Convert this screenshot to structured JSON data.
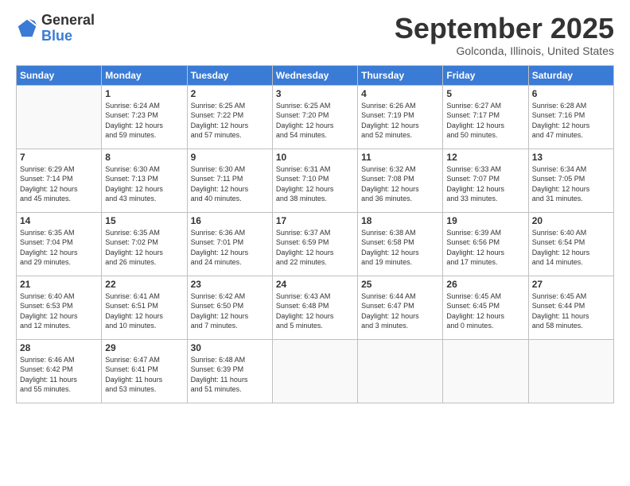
{
  "header": {
    "logo_general": "General",
    "logo_blue": "Blue",
    "month_title": "September 2025",
    "location": "Golconda, Illinois, United States"
  },
  "days_of_week": [
    "Sunday",
    "Monday",
    "Tuesday",
    "Wednesday",
    "Thursday",
    "Friday",
    "Saturday"
  ],
  "weeks": [
    [
      {
        "day": "",
        "info": ""
      },
      {
        "day": "1",
        "info": "Sunrise: 6:24 AM\nSunset: 7:23 PM\nDaylight: 12 hours\nand 59 minutes."
      },
      {
        "day": "2",
        "info": "Sunrise: 6:25 AM\nSunset: 7:22 PM\nDaylight: 12 hours\nand 57 minutes."
      },
      {
        "day": "3",
        "info": "Sunrise: 6:25 AM\nSunset: 7:20 PM\nDaylight: 12 hours\nand 54 minutes."
      },
      {
        "day": "4",
        "info": "Sunrise: 6:26 AM\nSunset: 7:19 PM\nDaylight: 12 hours\nand 52 minutes."
      },
      {
        "day": "5",
        "info": "Sunrise: 6:27 AM\nSunset: 7:17 PM\nDaylight: 12 hours\nand 50 minutes."
      },
      {
        "day": "6",
        "info": "Sunrise: 6:28 AM\nSunset: 7:16 PM\nDaylight: 12 hours\nand 47 minutes."
      }
    ],
    [
      {
        "day": "7",
        "info": "Sunrise: 6:29 AM\nSunset: 7:14 PM\nDaylight: 12 hours\nand 45 minutes."
      },
      {
        "day": "8",
        "info": "Sunrise: 6:30 AM\nSunset: 7:13 PM\nDaylight: 12 hours\nand 43 minutes."
      },
      {
        "day": "9",
        "info": "Sunrise: 6:30 AM\nSunset: 7:11 PM\nDaylight: 12 hours\nand 40 minutes."
      },
      {
        "day": "10",
        "info": "Sunrise: 6:31 AM\nSunset: 7:10 PM\nDaylight: 12 hours\nand 38 minutes."
      },
      {
        "day": "11",
        "info": "Sunrise: 6:32 AM\nSunset: 7:08 PM\nDaylight: 12 hours\nand 36 minutes."
      },
      {
        "day": "12",
        "info": "Sunrise: 6:33 AM\nSunset: 7:07 PM\nDaylight: 12 hours\nand 33 minutes."
      },
      {
        "day": "13",
        "info": "Sunrise: 6:34 AM\nSunset: 7:05 PM\nDaylight: 12 hours\nand 31 minutes."
      }
    ],
    [
      {
        "day": "14",
        "info": "Sunrise: 6:35 AM\nSunset: 7:04 PM\nDaylight: 12 hours\nand 29 minutes."
      },
      {
        "day": "15",
        "info": "Sunrise: 6:35 AM\nSunset: 7:02 PM\nDaylight: 12 hours\nand 26 minutes."
      },
      {
        "day": "16",
        "info": "Sunrise: 6:36 AM\nSunset: 7:01 PM\nDaylight: 12 hours\nand 24 minutes."
      },
      {
        "day": "17",
        "info": "Sunrise: 6:37 AM\nSunset: 6:59 PM\nDaylight: 12 hours\nand 22 minutes."
      },
      {
        "day": "18",
        "info": "Sunrise: 6:38 AM\nSunset: 6:58 PM\nDaylight: 12 hours\nand 19 minutes."
      },
      {
        "day": "19",
        "info": "Sunrise: 6:39 AM\nSunset: 6:56 PM\nDaylight: 12 hours\nand 17 minutes."
      },
      {
        "day": "20",
        "info": "Sunrise: 6:40 AM\nSunset: 6:54 PM\nDaylight: 12 hours\nand 14 minutes."
      }
    ],
    [
      {
        "day": "21",
        "info": "Sunrise: 6:40 AM\nSunset: 6:53 PM\nDaylight: 12 hours\nand 12 minutes."
      },
      {
        "day": "22",
        "info": "Sunrise: 6:41 AM\nSunset: 6:51 PM\nDaylight: 12 hours\nand 10 minutes."
      },
      {
        "day": "23",
        "info": "Sunrise: 6:42 AM\nSunset: 6:50 PM\nDaylight: 12 hours\nand 7 minutes."
      },
      {
        "day": "24",
        "info": "Sunrise: 6:43 AM\nSunset: 6:48 PM\nDaylight: 12 hours\nand 5 minutes."
      },
      {
        "day": "25",
        "info": "Sunrise: 6:44 AM\nSunset: 6:47 PM\nDaylight: 12 hours\nand 3 minutes."
      },
      {
        "day": "26",
        "info": "Sunrise: 6:45 AM\nSunset: 6:45 PM\nDaylight: 12 hours\nand 0 minutes."
      },
      {
        "day": "27",
        "info": "Sunrise: 6:45 AM\nSunset: 6:44 PM\nDaylight: 11 hours\nand 58 minutes."
      }
    ],
    [
      {
        "day": "28",
        "info": "Sunrise: 6:46 AM\nSunset: 6:42 PM\nDaylight: 11 hours\nand 55 minutes."
      },
      {
        "day": "29",
        "info": "Sunrise: 6:47 AM\nSunset: 6:41 PM\nDaylight: 11 hours\nand 53 minutes."
      },
      {
        "day": "30",
        "info": "Sunrise: 6:48 AM\nSunset: 6:39 PM\nDaylight: 11 hours\nand 51 minutes."
      },
      {
        "day": "",
        "info": ""
      },
      {
        "day": "",
        "info": ""
      },
      {
        "day": "",
        "info": ""
      },
      {
        "day": "",
        "info": ""
      }
    ]
  ]
}
